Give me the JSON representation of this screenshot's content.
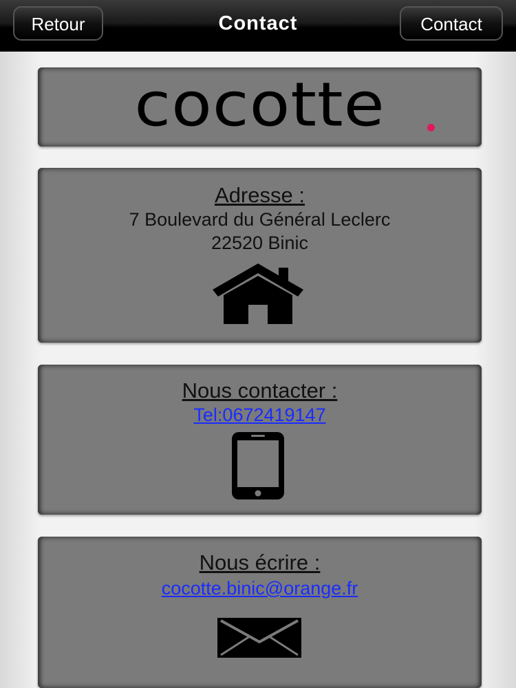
{
  "navbar": {
    "back_label": "Retour",
    "title": "Contact",
    "contact_label": "Contact"
  },
  "logo": {
    "text": "cocotte",
    "accent_color": "#e0185f"
  },
  "address": {
    "title": "Adresse :",
    "line1": "7 Boulevard du Général Leclerc",
    "line2": "22520 Binic",
    "icon": "house-icon"
  },
  "contact": {
    "title": "Nous contacter :",
    "phone_link": "Tel:0672419147",
    "icon": "smartphone-icon"
  },
  "mail": {
    "title": "Nous écrire :",
    "email_link": "cocotte.binic@orange.fr",
    "icon": "envelope-icon"
  }
}
